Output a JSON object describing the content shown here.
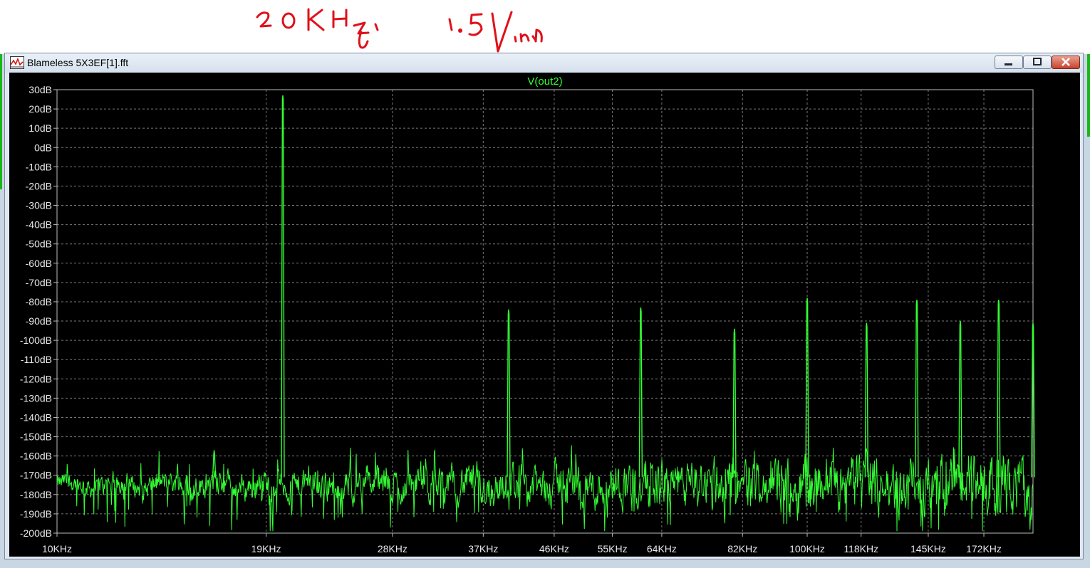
{
  "window": {
    "title": "Blameless 5X3EF[1].fft",
    "minimize_icon": "minimize-icon",
    "maximize_icon": "maximize-icon",
    "close_icon": "close-icon",
    "app_icon": "waveform-icon"
  },
  "annotation": {
    "handwritten_notes": [
      "20KHz",
      "1.5Vin"
    ],
    "ink_color": "#e0101a"
  },
  "colors": {
    "trace": "#33ff33",
    "background": "#000000",
    "grid": "#7a7a7a",
    "axis_text": "#e8e8e8",
    "title_text": "#33ff33"
  },
  "chart_data": {
    "type": "line",
    "title": "V(out2)",
    "xlabel": "",
    "ylabel": "",
    "xlim": [
      10,
      200
    ],
    "ylim": [
      -200,
      30
    ],
    "grid": true,
    "legend": "none",
    "x_ticks": [
      10,
      19,
      28,
      37,
      46,
      55,
      64,
      82,
      100,
      118,
      145,
      172
    ],
    "x_tick_labels": [
      "10KHz",
      "19KHz",
      "28KHz",
      "37KHz",
      "46KHz",
      "55KHz",
      "64KHz",
      "82KHz",
      "100KHz",
      "118KHz",
      "145KHz",
      "172KHz"
    ],
    "y_ticks": [
      30,
      20,
      10,
      0,
      -10,
      -20,
      -30,
      -40,
      -50,
      -60,
      -70,
      -80,
      -90,
      -100,
      -110,
      -120,
      -130,
      -140,
      -150,
      -160,
      -170,
      -180,
      -190,
      -200
    ],
    "y_tick_labels": [
      "30dB",
      "20dB",
      "10dB",
      "0dB",
      "-10dB",
      "-20dB",
      "-30dB",
      "-40dB",
      "-50dB",
      "-60dB",
      "-70dB",
      "-80dB",
      "-90dB",
      "-100dB",
      "-110dB",
      "-120dB",
      "-130dB",
      "-140dB",
      "-150dB",
      "-160dB",
      "-170dB",
      "-180dB",
      "-190dB",
      "-200dB"
    ],
    "x_unit": "KHz",
    "y_unit": "dB",
    "series": [
      {
        "noise_floor_db": -175,
        "peaks": [
          {
            "x": 16.2,
            "y": -157
          },
          {
            "x": 20.0,
            "y": 27
          },
          {
            "x": 40.0,
            "y": -84
          },
          {
            "x": 60.0,
            "y": -83
          },
          {
            "x": 80.0,
            "y": -94
          },
          {
            "x": 100.0,
            "y": -78
          },
          {
            "x": 120.0,
            "y": -91
          },
          {
            "x": 140.0,
            "y": -79
          },
          {
            "x": 160.0,
            "y": -90
          },
          {
            "x": 180.0,
            "y": -79
          },
          {
            "x": 200.0,
            "y": -91
          }
        ]
      }
    ]
  }
}
